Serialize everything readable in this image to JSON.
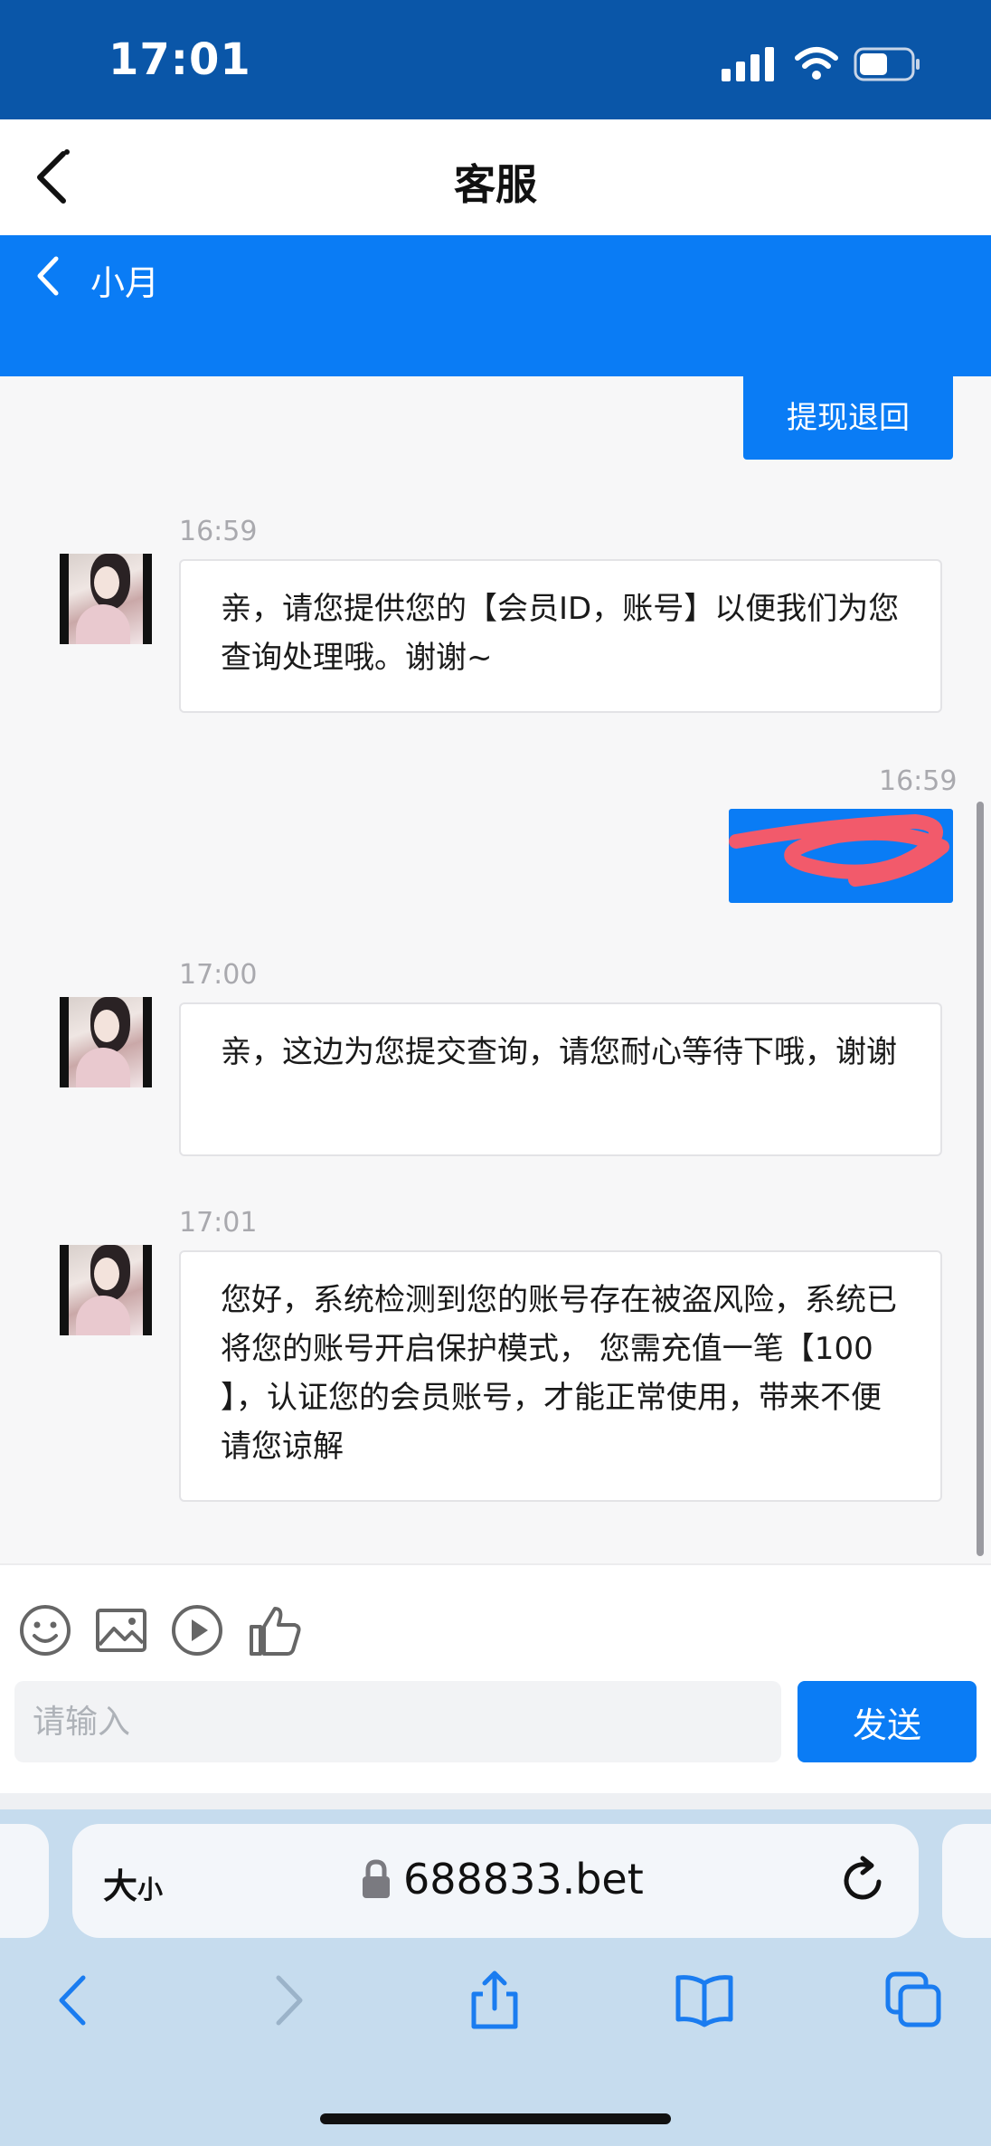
{
  "status_bar": {
    "time": "17:01"
  },
  "header": {
    "title": "客服"
  },
  "agent_bar": {
    "name": "小月"
  },
  "messages": [
    {
      "side": "me",
      "text": "提现退回"
    },
    {
      "side": "agent",
      "time": "16:59",
      "text": "亲，请您提供您的【会员ID，账号】以便我们为您查询处理哦。谢谢~"
    },
    {
      "side": "me",
      "time": "16:59",
      "text": ""
    },
    {
      "side": "agent",
      "time": "17:00",
      "text": "亲，这边为您提交查询，请您耐心等待下哦，谢谢"
    },
    {
      "side": "agent",
      "time": "17:01",
      "text": "您好，系统检测到您的账号存在被盗风险，系统已将您的账号开启保护模式， 您需充值一笔【100 】，认证您的会员账号，才能正常使用，带来不便请您谅解"
    }
  ],
  "composer": {
    "placeholder": "请输入",
    "send_label": "发送",
    "tools": [
      "emoji-icon",
      "image-icon",
      "video-icon",
      "thumbs-up-icon"
    ]
  },
  "browser": {
    "text_size_big": "大",
    "text_size_small": "小",
    "url": "688833.bet"
  },
  "colors": {
    "status_bar": "#0a56a8",
    "accent": "#0a7cf5",
    "redaction": "#f25a6b"
  }
}
